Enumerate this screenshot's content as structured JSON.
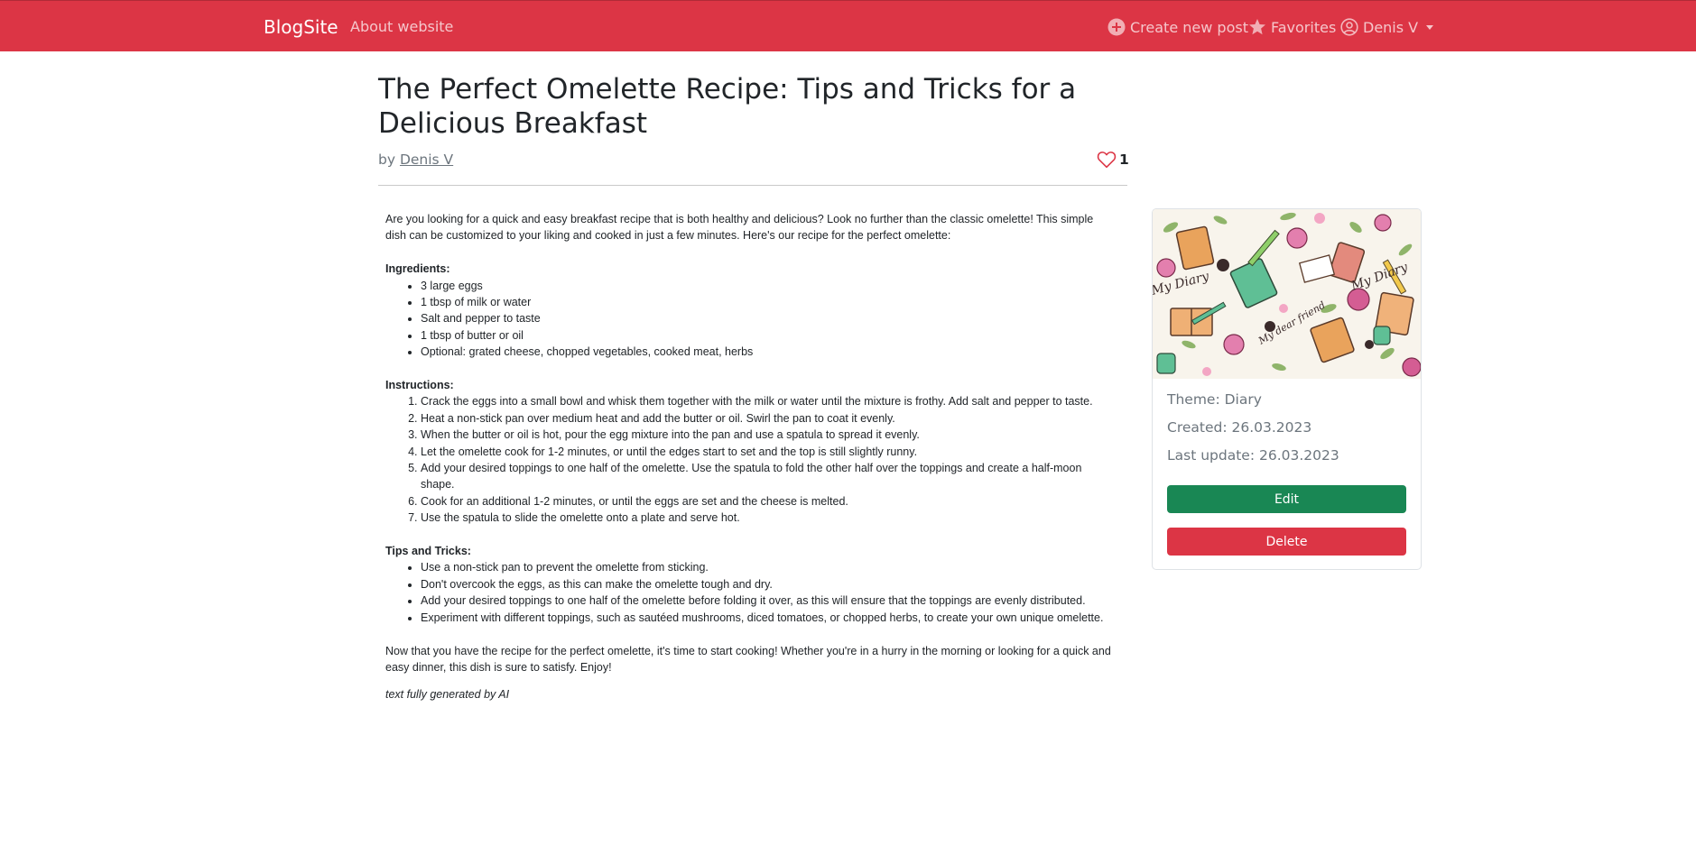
{
  "navbar": {
    "brand": "BlogSite",
    "about": "About website",
    "create_post": "Create new post",
    "favorites": "Favorites",
    "user_name": "Denis V",
    "icons": {
      "create": "plus-circle-icon",
      "favorites": "star-icon",
      "user": "user-circle-icon",
      "dropdown": "caret-down-icon"
    },
    "color": "#dc3545"
  },
  "post": {
    "title": "The Perfect Omelette Recipe: Tips and Tricks for a Delicious Breakfast",
    "by_label": "by",
    "author": "Denis V",
    "likes": "1",
    "like_icon": "heart-outline-icon"
  },
  "article": {
    "intro": "Are you looking for a quick and easy breakfast recipe that is both healthy and delicious? Look no further than the classic omelette! This simple dish can be customized to your liking and cooked in just a few minutes. Here's our recipe for the perfect omelette:",
    "ingredients_heading": "Ingredients:",
    "ingredients": [
      "3 large eggs",
      "1 tbsp of milk or water",
      "Salt and pepper to taste",
      "1 tbsp of butter or oil",
      "Optional: grated cheese, chopped vegetables, cooked meat, herbs"
    ],
    "instructions_heading": "Instructions:",
    "instructions": [
      "Crack the eggs into a small bowl and whisk them together with the milk or water until the mixture is frothy. Add salt and pepper to taste.",
      "Heat a non-stick pan over medium heat and add the butter or oil. Swirl the pan to coat it evenly.",
      "When the butter or oil is hot, pour the egg mixture into the pan and use a spatula to spread it evenly.",
      "Let the omelette cook for 1-2 minutes, or until the edges start to set and the top is still slightly runny.",
      "Add your desired toppings to one half of the omelette. Use the spatula to fold the other half over the toppings and create a half-moon shape.",
      "Cook for an additional 1-2 minutes, or until the eggs are set and the cheese is melted.",
      "Use the spatula to slide the omelette onto a plate and serve hot."
    ],
    "tips_heading": "Tips and Tricks:",
    "tips": [
      "Use a non-stick pan to prevent the omelette from sticking.",
      "Don't overcook the eggs, as this can make the omelette tough and dry.",
      "Add your desired toppings to one half of the omelette before folding it over, as this will ensure that the toppings are evenly distributed.",
      "Experiment with different toppings, such as sautéed mushrooms, diced tomatoes, or chopped herbs, to create your own unique omelette."
    ],
    "outro": "Now that you have the recipe for the perfect omelette, it's time to start cooking! Whether you're in a hurry in the morning or looking for a quick and easy dinner, this dish is sure to satisfy. Enjoy!",
    "credit": "text fully generated by AI"
  },
  "sidebar": {
    "theme": "Theme: Diary",
    "created": "Created: 26.03.2023",
    "updated": "Last update: 26.03.2023",
    "edit_label": "Edit",
    "delete_label": "Delete",
    "edit_color": "#198754",
    "delete_color": "#dc3545",
    "image_lettering": [
      "My Diary",
      "My dear friend",
      "My Diary"
    ]
  }
}
